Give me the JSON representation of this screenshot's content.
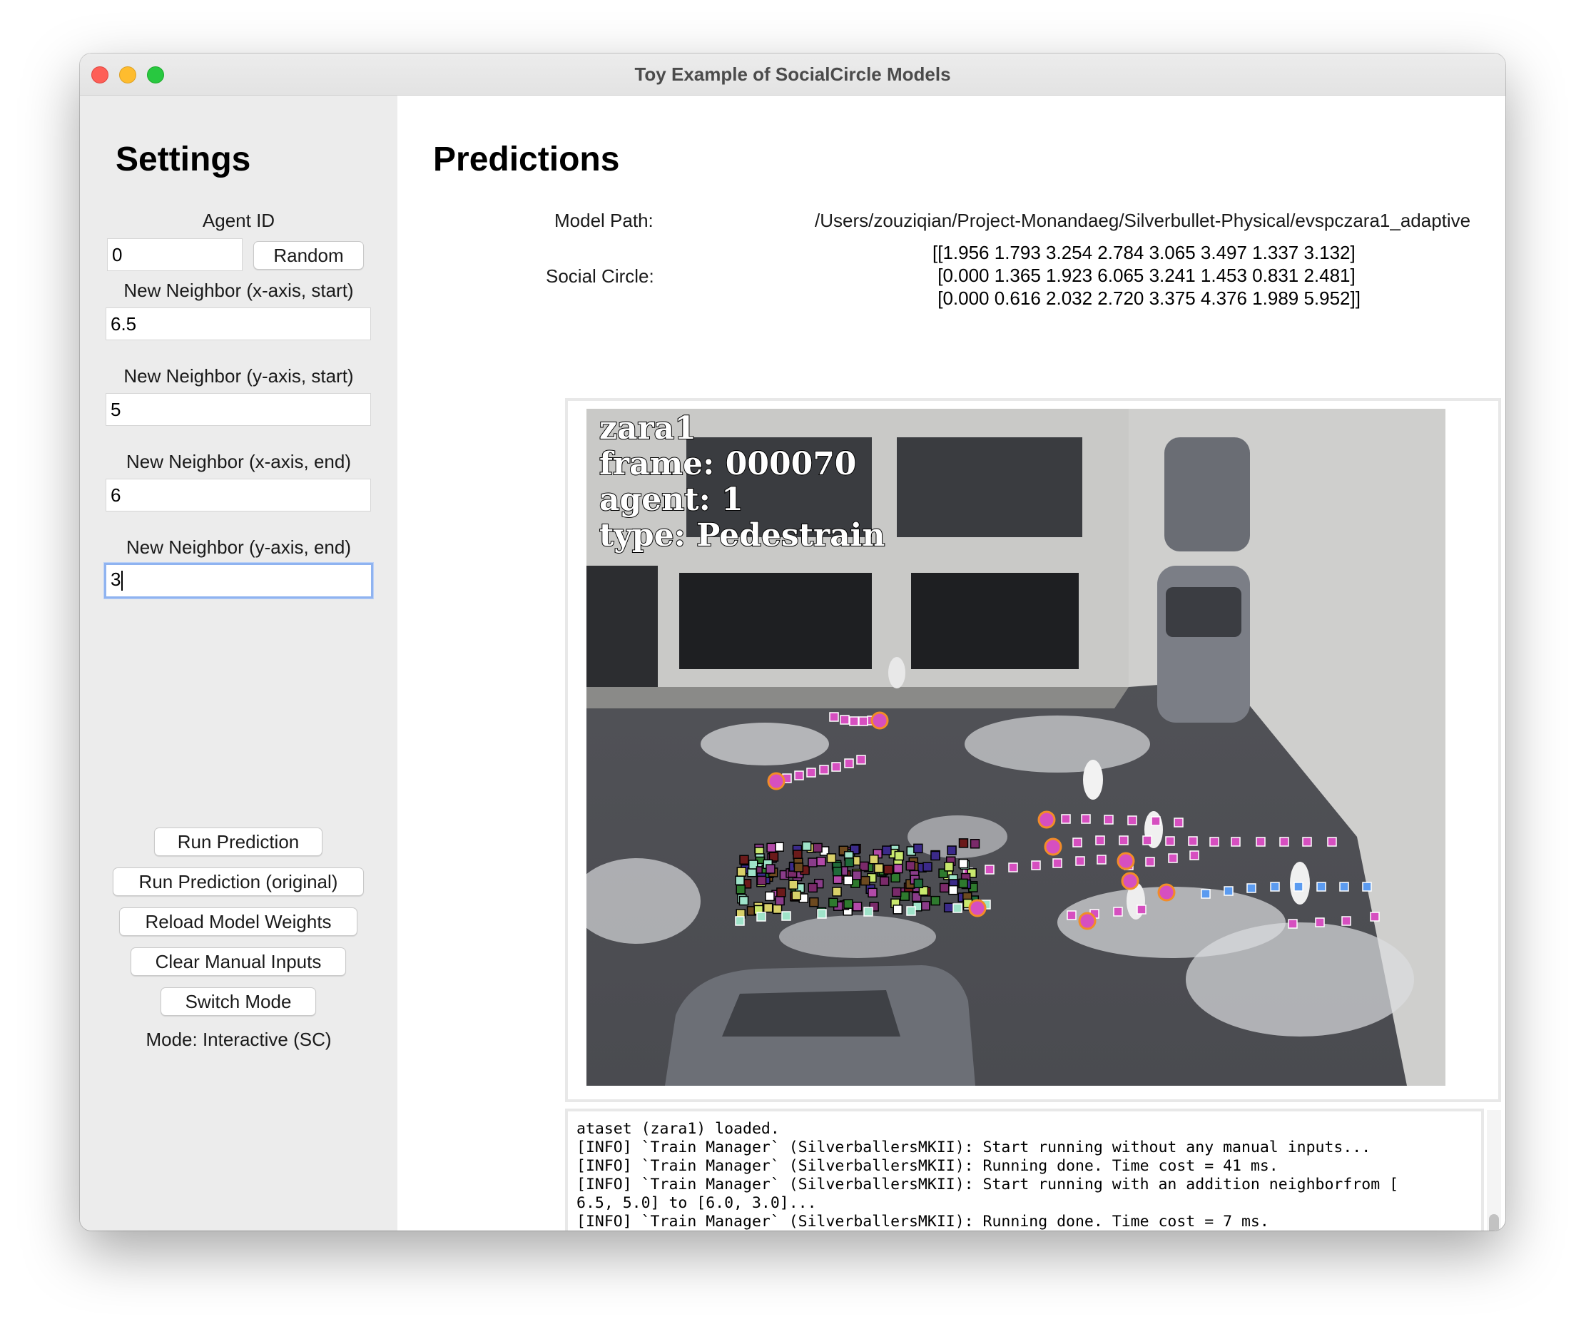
{
  "window": {
    "title": "Toy Example of SocialCircle Models"
  },
  "settings": {
    "heading": "Settings",
    "agent_id_label": "Agent ID",
    "agent_id_value": "0",
    "random_button": "Random",
    "x_start_label": "New Neighbor (x-axis, start)",
    "x_start_value": "6.5",
    "y_start_label": "New Neighbor (y-axis, start)",
    "y_start_value": "5",
    "x_end_label": "New Neighbor (x-axis, end)",
    "x_end_value": "6",
    "y_end_label": "New Neighbor (y-axis, end)",
    "y_end_value": "3",
    "buttons": {
      "run_prediction": "Run Prediction",
      "run_prediction_original": "Run Prediction (original)",
      "reload_weights": "Reload Model Weights",
      "clear_inputs": "Clear Manual Inputs",
      "switch_mode": "Switch Mode"
    },
    "mode_text": "Mode: Interactive (SC)"
  },
  "predictions": {
    "heading": "Predictions",
    "model_path_label": "Model Path:",
    "model_path_value": "/Users/zouziqian/Project-Monandaeg/Silverbullet-Physical/evspczara1_adaptive",
    "social_circle_label": "Social Circle:",
    "social_circle_rows": [
      "[[1.956 1.793 3.254 2.784 3.065 3.497 1.337 3.132]",
      " [0.000 1.365 1.923 6.065 3.241 1.453 0.831 2.481]",
      " [0.000 0.616 2.032 2.720 3.375 4.376 1.989 5.952]]"
    ],
    "overlay": {
      "line1": "zara1",
      "line2": "frame: 000070",
      "line3": "agent: 1",
      "line4": "type: Pedestrain"
    }
  },
  "console": {
    "lines": [
      "ataset (zara1) loaded.",
      "[INFO] `Train Manager` (SilverballersMKII): Start running without any manual inputs...",
      "[INFO] `Train Manager` (SilverballersMKII): Running done. Time cost = 41 ms.",
      "[INFO] `Train Manager` (SilverballersMKII): Start running with an addition neighborfrom [",
      "6.5, 5.0] to [6.0, 3.0]...",
      "[INFO] `Train Manager` (SilverballersMKII): Running done. Time cost = 7 ms."
    ]
  },
  "colors": {
    "obs_marker": "#d64fc0",
    "obs_ring": "#f28c28",
    "pred_marker": "#5b9bf0",
    "accent_focus": "#8fb3f0"
  }
}
